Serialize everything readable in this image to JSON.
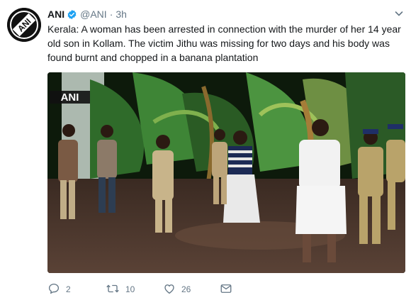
{
  "tweet": {
    "author_name": "ANI",
    "author_handle": "@ANI",
    "separator": "·",
    "time": "3h",
    "text": "Kerala: A woman has been arrested in connection with the murder of her 14 year old son in Kollam. The victim Jithu was missing for two days and his body was found burnt and chopped in a banana plantation",
    "media_watermark": "ANI",
    "verified_color": "#1da1f2"
  },
  "actions": {
    "replies": "2",
    "retweets": "10",
    "likes": "26"
  },
  "icons": {
    "avatar": "ani-logo-icon",
    "verified": "verified-badge-icon",
    "menu": "chevron-down-icon",
    "reply": "reply-icon",
    "retweet": "retweet-icon",
    "like": "heart-icon",
    "dm": "direct-message-icon"
  }
}
